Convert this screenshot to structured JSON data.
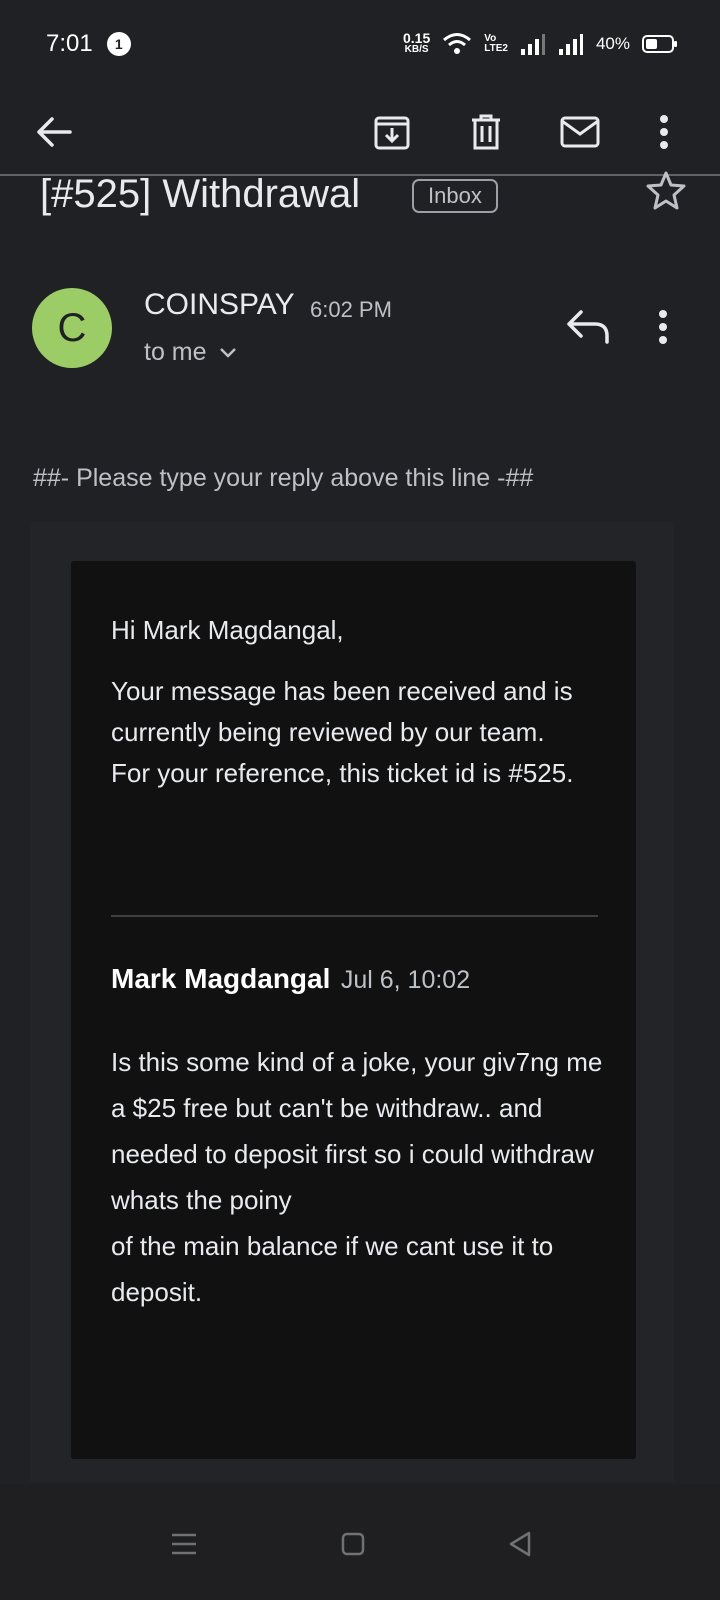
{
  "status_bar": {
    "time": "7:01",
    "notification_count": "1",
    "net_speed_value": "0.15",
    "net_speed_unit": "KB/S",
    "volte_top": "Vo",
    "volte_bottom": "LTE2",
    "battery": "40%"
  },
  "toolbar": {
    "icons": [
      "back-arrow-icon",
      "archive-icon",
      "delete-icon",
      "mark-unread-icon",
      "more-vert-icon"
    ]
  },
  "email": {
    "subject": "[#525] Withdrawal",
    "label": "Inbox",
    "avatar_letter": "C",
    "avatar_color": "#9ccc65",
    "sender": "COINSPAY",
    "time": "6:02 PM",
    "recipient": "to me",
    "reply_marker": "##- Please type your reply above this line -##",
    "greeting": "Hi Mark Magdangal,",
    "message": "Your message has been received and is currently being reviewed by our team.\nFor your reference, this ticket id is #525.",
    "quote_name": "Mark Magdangal",
    "quote_date": "Jul 6, 10:02",
    "quote_body": "Is this some kind of a joke, your giv7ng me a $25 free but can't be withdraw.. and needed to deposit first so i could withdraw whats the poiny\nof the main balance if we cant use it to deposit."
  },
  "nav_bar": {
    "icons": [
      "menu-icon",
      "home-square-icon",
      "back-triangle-icon"
    ]
  }
}
